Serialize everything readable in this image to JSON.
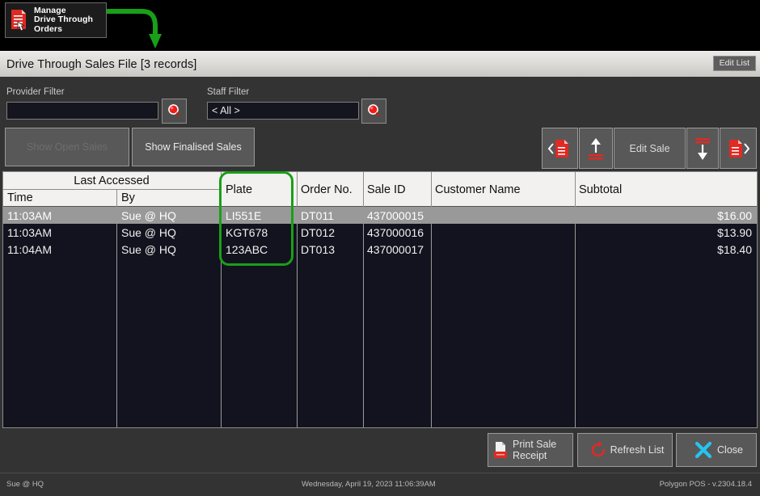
{
  "callout": {
    "text": "Manage\nDrive Through\nOrders",
    "icon": "document-hand-icon",
    "arrow_color": "#18a018"
  },
  "window": {
    "title": "Drive Through Sales File [3 records]",
    "edit_list_label": "Edit List"
  },
  "filters": {
    "provider": {
      "label": "Provider Filter",
      "value": "",
      "placeholder": "",
      "search_icon": "magnifier-icon"
    },
    "staff": {
      "label": "Staff Filter",
      "value": "< All >",
      "placeholder": "",
      "search_icon": "magnifier-icon"
    }
  },
  "mode_buttons": {
    "open": {
      "label": "Show Open Sales",
      "enabled": false
    },
    "finalised": {
      "label": "Show Finalised Sales",
      "enabled": true
    }
  },
  "nav_toolbar": [
    {
      "name": "first-record-button",
      "label": "",
      "icon": "first-record-icon"
    },
    {
      "name": "move-up-button",
      "label": "",
      "icon": "arrow-up-icon"
    },
    {
      "name": "edit-sale-button",
      "label": "Edit Sale",
      "icon": ""
    },
    {
      "name": "move-down-button",
      "label": "",
      "icon": "arrow-down-icon"
    },
    {
      "name": "last-record-button",
      "label": "",
      "icon": "last-record-icon"
    }
  ],
  "grid": {
    "group_header": "Last Accessed",
    "columns": [
      "Time",
      "By",
      "Plate",
      "Order No.",
      "Sale ID",
      "Customer Name",
      "Subtotal"
    ],
    "rows": [
      {
        "time": "11:03AM",
        "by": "Sue @ HQ",
        "plate": "LI551E",
        "order_no": "DT011",
        "sale_id": "437000015",
        "customer_name": "",
        "subtotal": "$16.00",
        "selected": true
      },
      {
        "time": "11:03AM",
        "by": "Sue @ HQ",
        "plate": "KGT678",
        "order_no": "DT012",
        "sale_id": "437000016",
        "customer_name": "",
        "subtotal": "$13.90",
        "selected": false
      },
      {
        "time": "11:04AM",
        "by": "Sue @ HQ",
        "plate": "123ABC",
        "order_no": "DT013",
        "sale_id": "437000017",
        "customer_name": "",
        "subtotal": "$18.40",
        "selected": false
      }
    ]
  },
  "bottom_buttons": {
    "print": {
      "label": "Print Sale\nReceipt",
      "icon": "printer-icon"
    },
    "refresh": {
      "label": "Refresh List",
      "icon": "refresh-icon"
    },
    "close": {
      "label": "Close",
      "icon": "close-x-icon"
    }
  },
  "statusbar": {
    "user": "Sue @ HQ",
    "datetime": "Wednesday, April 19, 2023    11:06:39AM",
    "version": "Polygon POS - v.2304.18.4"
  },
  "colors": {
    "accent_red": "#e02a23",
    "highlight_green": "#18a018",
    "close_cyan": "#25c4f0",
    "selected_row": "#999999"
  }
}
